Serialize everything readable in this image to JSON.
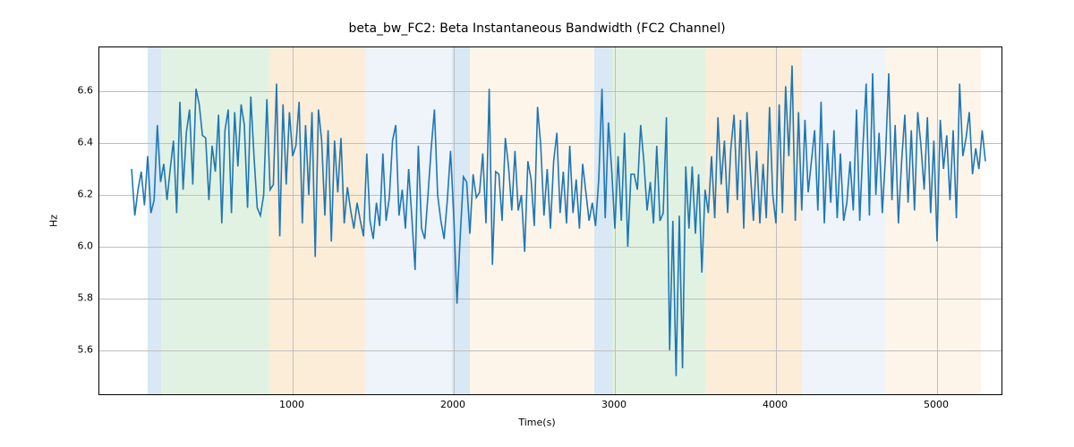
{
  "chart_data": {
    "type": "line",
    "title": "beta_bw_FC2: Beta Instantaneous Bandwidth (FC2 Channel)",
    "xlabel": "Time(s)",
    "ylabel": "Hz",
    "xlim": [
      -200,
      5400
    ],
    "ylim": [
      5.43,
      6.77
    ],
    "xticks": [
      1000,
      2000,
      3000,
      4000,
      5000
    ],
    "yticks": [
      5.6,
      5.8,
      6.0,
      6.2,
      6.4,
      6.6
    ],
    "bands": [
      {
        "start": 100,
        "end": 185,
        "color": "#a8cbe6"
      },
      {
        "start": 185,
        "end": 855,
        "color": "#bfe3bf"
      },
      {
        "start": 855,
        "end": 1450,
        "color": "#f7d6a8"
      },
      {
        "start": 1450,
        "end": 1990,
        "color": "#d9e6f2"
      },
      {
        "start": 1990,
        "end": 2100,
        "color": "#a8cbe6"
      },
      {
        "start": 2100,
        "end": 2870,
        "color": "#fbe9d0"
      },
      {
        "start": 2870,
        "end": 2985,
        "color": "#a8cbe6"
      },
      {
        "start": 2985,
        "end": 3560,
        "color": "#bfe3bf"
      },
      {
        "start": 3560,
        "end": 4160,
        "color": "#f7d6a8"
      },
      {
        "start": 4160,
        "end": 4680,
        "color": "#d9e6f2"
      },
      {
        "start": 4680,
        "end": 5270,
        "color": "#fbe9d0"
      }
    ],
    "series": [
      {
        "name": "beta_bw_FC2",
        "color": "#1f77b4",
        "x_start": 0,
        "x_step": 20,
        "y": [
          6.3,
          6.12,
          6.22,
          6.29,
          6.16,
          6.35,
          6.13,
          6.18,
          6.47,
          6.25,
          6.32,
          6.18,
          6.3,
          6.41,
          6.13,
          6.56,
          6.22,
          6.44,
          6.53,
          6.24,
          6.61,
          6.55,
          6.43,
          6.42,
          6.18,
          6.39,
          6.29,
          6.51,
          6.09,
          6.45,
          6.53,
          6.13,
          6.52,
          6.31,
          6.55,
          6.47,
          6.15,
          6.58,
          6.35,
          6.15,
          6.12,
          6.2,
          6.57,
          6.22,
          6.24,
          6.63,
          6.04,
          6.55,
          6.24,
          6.52,
          6.35,
          6.39,
          6.56,
          6.09,
          6.47,
          6.2,
          6.52,
          5.96,
          6.53,
          6.41,
          6.12,
          6.45,
          6.02,
          6.41,
          6.21,
          6.42,
          6.09,
          6.23,
          6.14,
          6.07,
          6.17,
          6.1,
          6.04,
          6.36,
          6.1,
          6.03,
          6.17,
          6.08,
          6.36,
          6.1,
          6.19,
          6.41,
          6.47,
          6.12,
          6.22,
          6.07,
          6.3,
          6.11,
          5.91,
          6.39,
          6.07,
          6.03,
          6.2,
          6.38,
          6.53,
          6.2,
          6.1,
          6.03,
          6.18,
          6.37,
          6.12,
          5.78,
          6.04,
          6.27,
          6.25,
          6.05,
          6.28,
          6.19,
          6.21,
          6.36,
          6.09,
          6.61,
          5.93,
          6.29,
          6.28,
          6.1,
          6.42,
          6.31,
          6.14,
          6.37,
          6.14,
          6.2,
          5.98,
          6.33,
          6.26,
          6.08,
          6.54,
          6.39,
          6.12,
          6.3,
          6.07,
          6.33,
          6.44,
          6.13,
          6.29,
          6.09,
          6.39,
          6.13,
          6.26,
          6.07,
          6.32,
          6.21,
          6.1,
          6.17,
          6.08,
          6.26,
          6.61,
          6.11,
          6.48,
          6.3,
          6.07,
          6.35,
          6.1,
          6.44,
          6.0,
          6.28,
          6.28,
          6.22,
          6.47,
          6.33,
          6.14,
          6.25,
          6.09,
          6.39,
          6.1,
          6.13,
          6.5,
          5.6,
          6.1,
          5.5,
          6.12,
          5.53,
          6.31,
          6.07,
          6.31,
          6.05,
          6.28,
          5.9,
          6.22,
          6.13,
          6.35,
          6.11,
          6.5,
          6.24,
          6.41,
          6.13,
          6.38,
          6.51,
          6.18,
          6.49,
          6.07,
          6.52,
          6.3,
          6.1,
          6.37,
          6.09,
          6.32,
          6.11,
          6.54,
          6.2,
          6.09,
          6.55,
          6.13,
          6.62,
          6.35,
          6.7,
          6.1,
          6.52,
          6.14,
          6.49,
          6.21,
          6.33,
          6.45,
          6.14,
          6.56,
          6.09,
          6.4,
          6.17,
          6.45,
          6.11,
          6.36,
          6.1,
          6.17,
          6.33,
          6.14,
          6.53,
          6.1,
          6.39,
          6.63,
          6.12,
          6.67,
          6.2,
          6.44,
          6.13,
          6.35,
          6.67,
          6.18,
          6.47,
          6.09,
          6.33,
          6.51,
          6.17,
          6.45,
          6.14,
          6.52,
          6.39,
          6.22,
          6.5,
          6.13,
          6.41,
          6.02,
          6.49,
          6.3,
          6.43,
          6.18,
          6.45,
          6.11,
          6.63,
          6.35,
          6.42,
          6.52,
          6.28,
          6.38,
          6.3,
          6.45,
          6.33
        ]
      }
    ]
  }
}
